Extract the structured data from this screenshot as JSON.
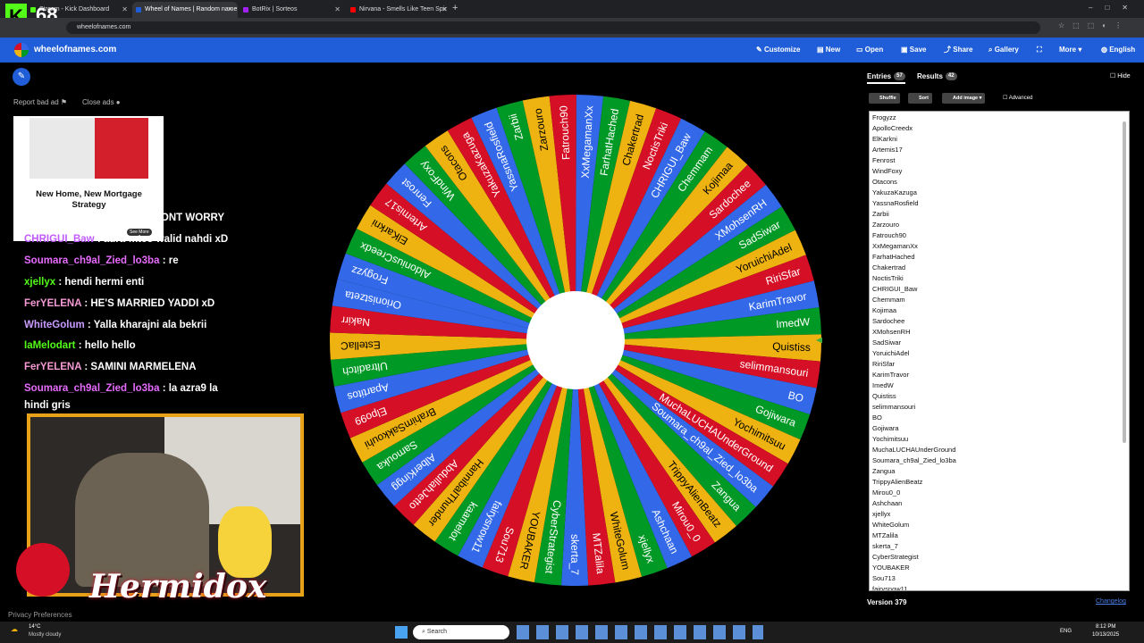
{
  "browser": {
    "kick_count": "68",
    "tabs": [
      {
        "title": "Stream - Kick Dashboard",
        "color": "#53fc18"
      },
      {
        "title": "Wheel of Names | Random name",
        "color": "#1f5ed8"
      },
      {
        "title": "BotRix | Sorteos",
        "color": "#a020f0"
      },
      {
        "title": "Nirvana - Smells Like Teen Spir",
        "color": "#ff0000"
      }
    ],
    "url": "wheelofnames.com"
  },
  "header": {
    "brand": "wheelofnames.com",
    "nav": [
      "Customize",
      "New",
      "Open",
      "Save",
      "Share",
      "Gallery",
      "More",
      "English"
    ]
  },
  "left": {
    "report_ad": "Report bad ad",
    "close_ads": "Close ads",
    "ad_title": "New Home, New Mortgage Strategy",
    "ad_cta": "See More",
    "privacy": "Privacy Preferences"
  },
  "chat": [
    {
      "user": "",
      "msg": "GIRLZ LOVE YOU HERMY DONT WORRY",
      "color": "#ffffff"
    },
    {
      "user": "CHRIGUI_Baw",
      "msg": ": aura-mteo walid nahdi xD",
      "color": "#c15bff"
    },
    {
      "user": "Soumara_ch9al_Zied_lo3ba",
      "msg": ": re",
      "color": "#e86bff"
    },
    {
      "user": "xjellyx",
      "msg": ": hendi hermi enti",
      "color": "#53fc18"
    },
    {
      "user": "FerYELENA",
      "msg": ": HE'S MARRIED YADDI xD",
      "color": "#f59ad4"
    },
    {
      "user": "WhiteGolum",
      "msg": ": Yalla kharajni ala bekrii",
      "color": "#c89bff"
    },
    {
      "user": "IaMelodart",
      "msg": ": hello hello",
      "color": "#53fc18"
    },
    {
      "user": "FerYELENA",
      "msg": ": SAMINI MARMELENA",
      "color": "#f59ad4"
    },
    {
      "user": "Soumara_ch9al_Zied_lo3ba",
      "msg": ": la azra9 la",
      "color": "#e86bff"
    },
    {
      "user": "",
      "msg": "hindi gris",
      "color": "#ffffff"
    }
  ],
  "overlay_name": "Hermidox",
  "wheel": {
    "colors": [
      "#3369e8",
      "#009925",
      "#eeb211",
      "#d50f25"
    ],
    "names": [
      "Frogyzz",
      "AldoniusCreedx",
      "ElKarkni",
      "Artemis17",
      "Fenrost",
      "WindFoxy",
      "Otacons",
      "YakuzaKazuga",
      "YassnaRosfield",
      "Zarbii",
      "Zarzouro",
      "Fatrouch90",
      "XxMegamanXx",
      "FarhatHached",
      "Chakertrad",
      "NoctisTriki",
      "CHRIGUI_Baw",
      "Chemmam",
      "Kojimaa",
      "Sardochee",
      "XMohsenRH",
      "SadSiwar",
      "YoruichiAdel",
      "RiriSfar",
      "KarimTravor",
      "ImedW",
      "Quistiss",
      "selimmansouri",
      "BO",
      "Gojiwara",
      "Yochimitsuu",
      "MuchaLUCHAUnderGround",
      "Soumara_ch9al_Zied_lo3ba",
      "Zangua",
      "TrippyAlienBeatz",
      "Mirou0_0",
      "Ashchaan",
      "xjellyx",
      "WhiteGolum",
      "MTZalila",
      "skerta_7",
      "CyberStrategist",
      "YOUBAKER",
      "Sou713",
      "fairysnow11",
      "kaamelot",
      "HannibalThunder",
      "AbdullahJetto",
      "AlberKingg",
      "Samouka",
      "BrahimSakkouhi",
      "Elpo99",
      "Apartitos",
      "Ultraditch",
      "EstellaC",
      "Nakirr",
      "Orionistzeta"
    ]
  },
  "panel": {
    "entries_label": "Entries",
    "entries_count": "57",
    "results_label": "Results",
    "results_count": "42",
    "hide": "Hide",
    "shuffle": "Shuffle",
    "sort": "Sort",
    "add_image": "Add image",
    "advanced": "Advanced",
    "version": "Version 379",
    "changelog": "Changelog"
  },
  "entries": [
    "Frogyzz",
    "ApolloCreedx",
    "ElKarkni",
    "Artemis17",
    "Fenrost",
    "WindFoxy",
    "Otacons",
    "YakuzaKazuga",
    "YassnaRosfield",
    "Zarbii",
    "Zarzouro",
    "Fatrouch90",
    "XxMegamanXx",
    "FarhatHached",
    "Chakertrad",
    "NoctisTriki",
    "CHRIGUI_Baw",
    "Chemmam",
    "Kojimaa",
    "Sardochee",
    "XMohsenRH",
    "SadSiwar",
    "YoruichiAdel",
    "RiriSfar",
    "KarimTravor",
    "ImedW",
    "Quistiss",
    "selimmansouri",
    "BO",
    "Gojiwara",
    "Yochimitsuu",
    "MuchaLUCHAUnderGround",
    "Soumara_ch9al_Zied_lo3ba",
    "Zangua",
    "TrippyAlienBeatz",
    "Mirou0_0",
    "Ashchaan",
    "xjellyx",
    "WhiteGolum",
    "MTZalila",
    "skerta_7",
    "CyberStrategist",
    "YOUBAKER",
    "Sou713",
    "fairysnow11"
  ],
  "taskbar": {
    "weather": "14°C",
    "weather_desc": "Mostly cloudy",
    "search": "Search",
    "lang": "ENG",
    "time": "8:12 PM",
    "date": "10/13/2025"
  }
}
